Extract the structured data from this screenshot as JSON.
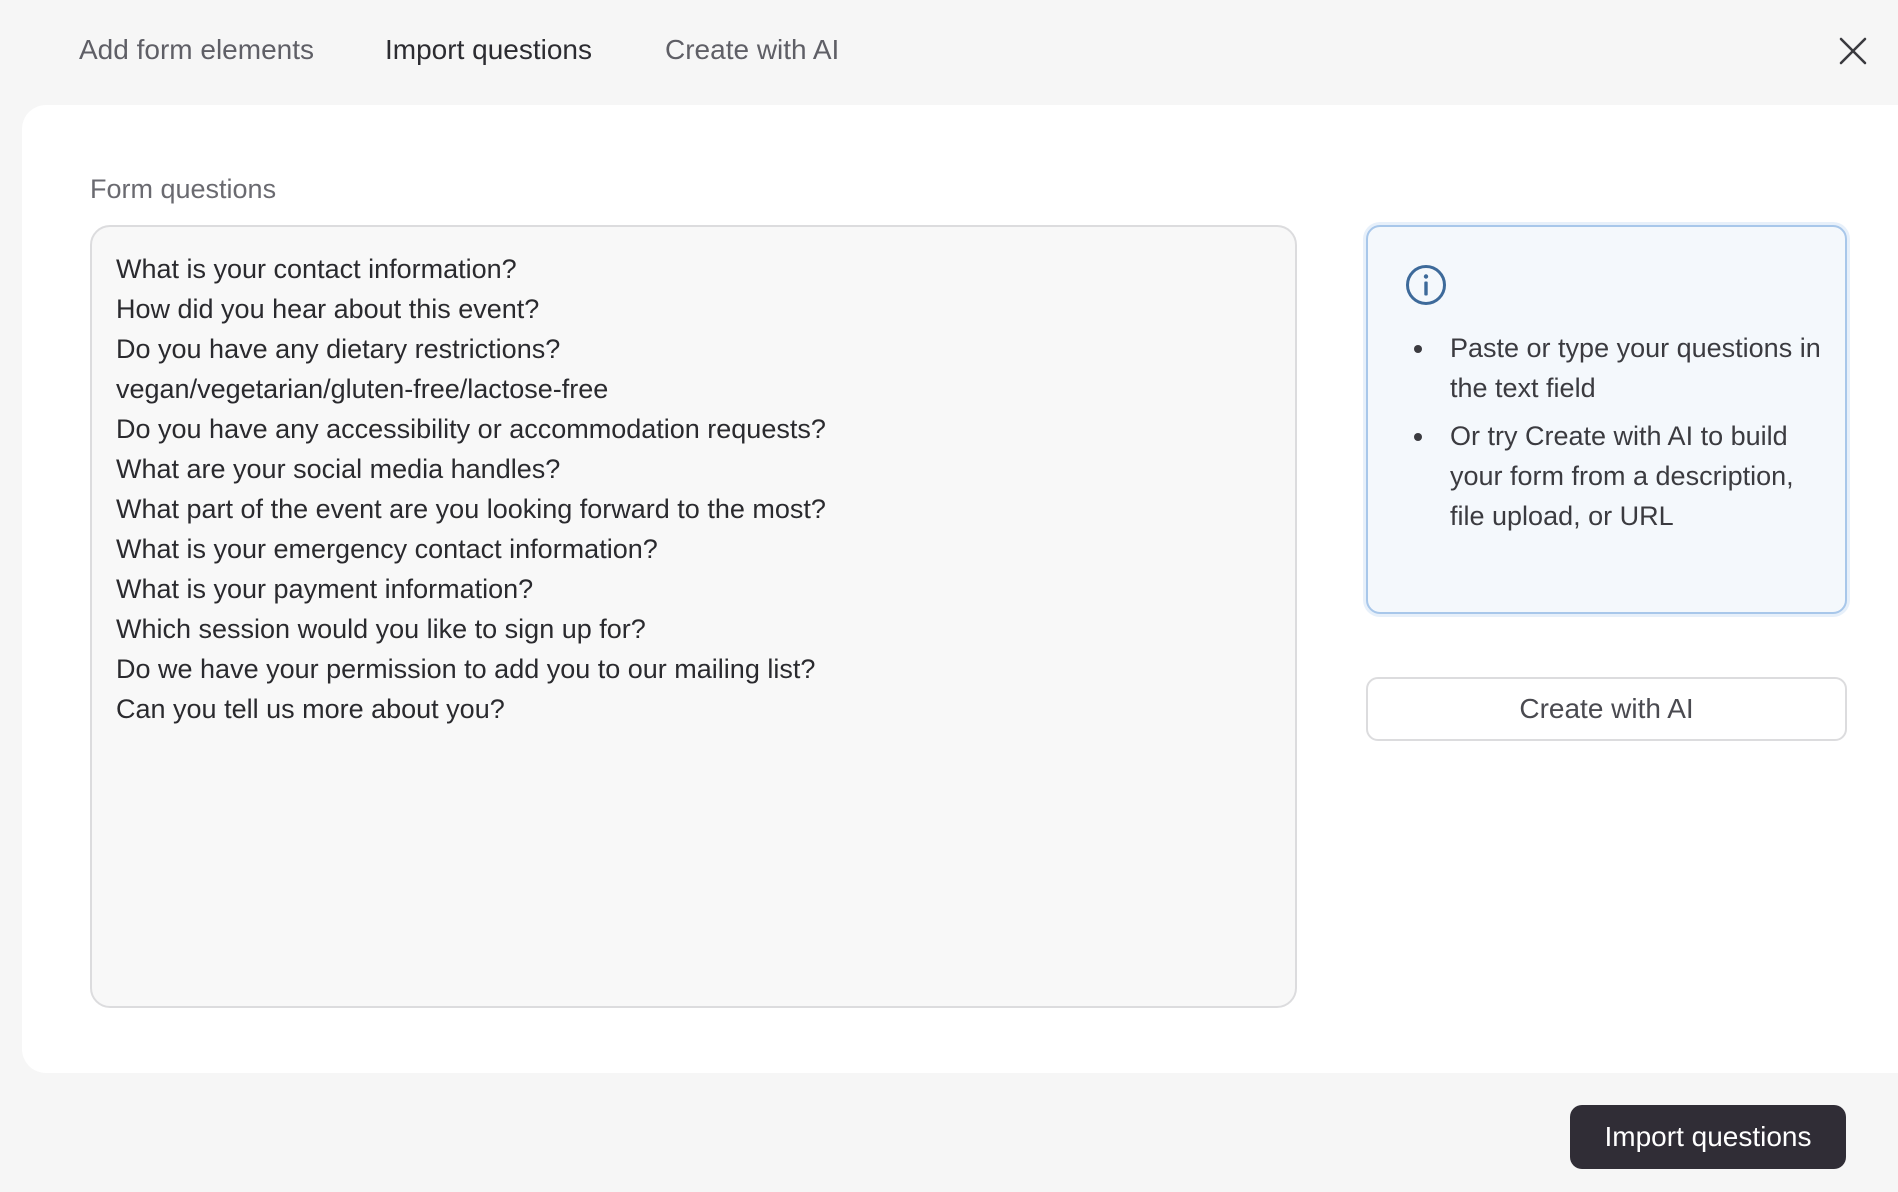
{
  "tabs": [
    {
      "label": "Add form elements",
      "active": false
    },
    {
      "label": "Import questions",
      "active": true
    },
    {
      "label": "Create with AI",
      "active": false
    }
  ],
  "close": {
    "icon": "close-icon"
  },
  "form": {
    "label": "Form questions",
    "lines": [
      "What is your contact information?",
      "How did you hear about this event?",
      "Do you have any dietary restrictions?",
      "vegan/vegetarian/gluten-free/lactose-free",
      "Do you have any accessibility or accommodation requests?",
      "What are your social media handles?",
      "What part of the event are you looking forward to the most?",
      "What is your emergency contact information?",
      "What is your payment information?",
      "Which session would you like to sign up for?",
      "Do we have your permission to add you to our mailing list?",
      "Can you tell us more about you?"
    ]
  },
  "info": {
    "icon": "info-icon",
    "items": [
      "Paste or type your questions in the text field",
      "Or try Create with AI to build your form from a description, file upload, or URL"
    ]
  },
  "buttons": {
    "create_ai": "Create with AI",
    "import": "Import questions"
  },
  "colors": {
    "background": "#f6f6f6",
    "card": "#ffffff",
    "info_bg": "#f4f8fc",
    "info_border": "#a8c7ea",
    "info_icon": "#3d6a9a",
    "primary_button": "#302d36"
  }
}
